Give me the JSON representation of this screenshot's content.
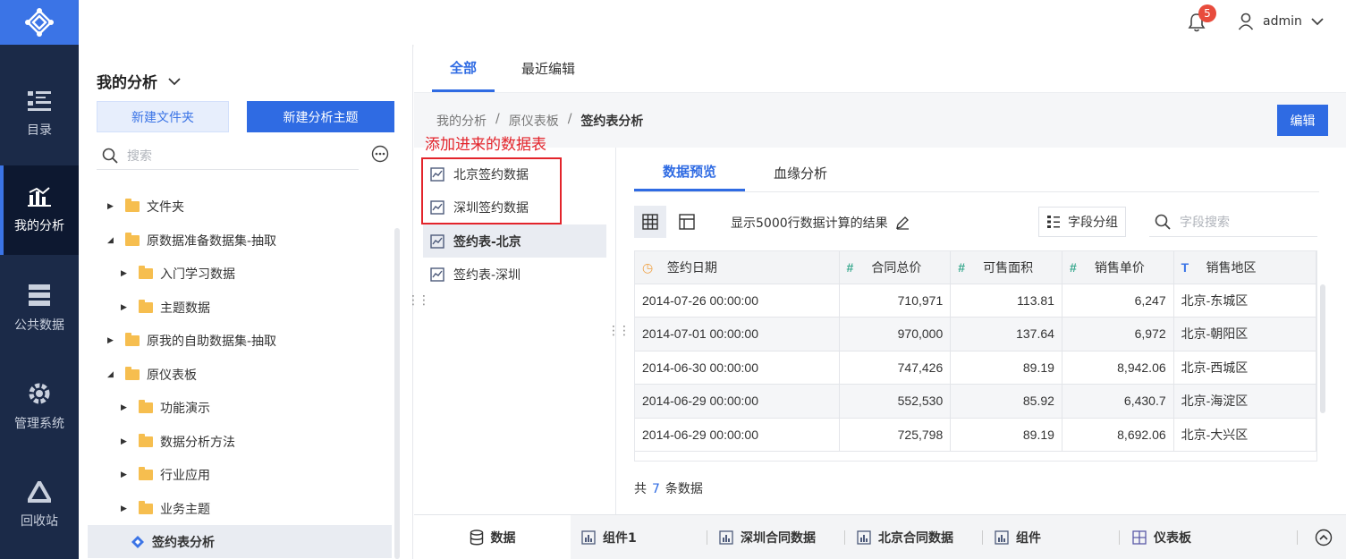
{
  "nav": {
    "items": [
      {
        "label": "目录",
        "icon": "list-icon"
      },
      {
        "label": "我的分析",
        "icon": "chart-icon"
      },
      {
        "label": "公共数据",
        "icon": "database-icon"
      },
      {
        "label": "管理系统",
        "icon": "gear-icon"
      },
      {
        "label": "回收站",
        "icon": "recycle-icon"
      }
    ]
  },
  "header": {
    "notification_count": "5",
    "user": "admin"
  },
  "left_panel": {
    "title": "我的分析",
    "new_folder": "新建文件夹",
    "new_topic": "新建分析主题",
    "search_placeholder": "搜索",
    "tree": [
      {
        "label": "文件夹"
      },
      {
        "label": "原数据准备数据集-抽取"
      },
      {
        "label": "入门学习数据"
      },
      {
        "label": "主题数据"
      },
      {
        "label": "原我的自助数据集-抽取"
      },
      {
        "label": "原仪表板"
      },
      {
        "label": "功能演示"
      },
      {
        "label": "数据分析方法"
      },
      {
        "label": "行业应用"
      },
      {
        "label": "业务主题"
      },
      {
        "label": "签约表分析"
      }
    ]
  },
  "main": {
    "tabs": [
      {
        "label": "全部"
      },
      {
        "label": "最近编辑"
      }
    ],
    "breadcrumb": [
      "我的分析",
      "/",
      "原仪表板",
      "/",
      "签约表分析"
    ],
    "edit_button": "编辑",
    "annotation": "添加进来的数据表",
    "tables": [
      {
        "label": "北京签约数据"
      },
      {
        "label": "深圳签约数据"
      },
      {
        "label": "签约表-北京"
      },
      {
        "label": "签约表-深圳"
      }
    ],
    "subtabs": [
      {
        "label": "数据预览"
      },
      {
        "label": "血缘分析"
      }
    ],
    "toolbar": {
      "info": "显示5000行数据计算的结果",
      "group": "字段分组",
      "search_placeholder": "字段搜索"
    },
    "grid": {
      "columns": [
        {
          "label": "签约日期",
          "type_icon": "clock-icon"
        },
        {
          "label": "合同总价",
          "type_icon": "number-icon"
        },
        {
          "label": "可售面积",
          "type_icon": "number-icon"
        },
        {
          "label": "销售单价",
          "type_icon": "number-icon"
        },
        {
          "label": "销售地区",
          "type_icon": "text-icon"
        }
      ],
      "rows": [
        [
          "2014-07-26 00:00:00",
          "710,971",
          "113.81",
          "6,247",
          "北京-东城区"
        ],
        [
          "2014-07-01 00:00:00",
          "970,000",
          "137.64",
          "6,972",
          "北京-朝阳区"
        ],
        [
          "2014-06-30 00:00:00",
          "747,426",
          "89.19",
          "8,942.06",
          "北京-西城区"
        ],
        [
          "2014-06-29 00:00:00",
          "552,530",
          "85.92",
          "6,430.7",
          "北京-海淀区"
        ],
        [
          "2014-06-29 00:00:00",
          "725,798",
          "89.19",
          "8,692.06",
          "北京-大兴区"
        ]
      ]
    },
    "total": {
      "prefix": "共",
      "count": "7",
      "suffix": "条数据"
    }
  },
  "bottom_tabs": [
    {
      "label": "数据"
    },
    {
      "label": "组件1"
    },
    {
      "label": "深圳合同数据"
    },
    {
      "label": "北京合同数据"
    },
    {
      "label": "组件"
    },
    {
      "label": "仪表板"
    }
  ],
  "colors": {
    "accent": "#2f6be3",
    "nav_bg": "#1b2a48",
    "annotation": "#e3242b"
  }
}
